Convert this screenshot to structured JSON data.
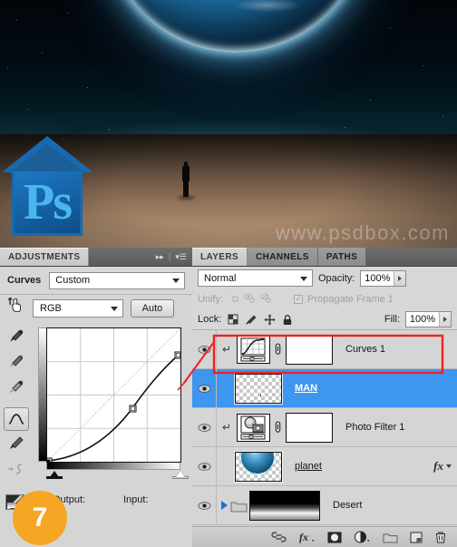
{
  "canvas": {
    "watermark": "www.psdbox.com",
    "logo_text": "Ps",
    "logo_name": "photoshop-house-logo",
    "scene_items": [
      "planet",
      "desert-ground",
      "man-silhouette",
      "starfield"
    ]
  },
  "adjustments_panel": {
    "tabs": [
      {
        "label": "ADJUSTMENTS",
        "active": true
      }
    ],
    "collapse_icon": "double-arrow-right-icon",
    "menu_icon": "panel-menu-icon",
    "title": "Curves",
    "preset": {
      "value": "Custom",
      "placeholder": "Custom"
    },
    "channel": {
      "value": "RGB"
    },
    "auto_button": "Auto",
    "output_label": "Output:",
    "input_label": "Input:",
    "tools": [
      {
        "name": "on-image-adjust-icon",
        "selected": false,
        "dimmed": false
      },
      {
        "name": "black-point-eyedropper-icon",
        "selected": false,
        "dimmed": false
      },
      {
        "name": "gray-point-eyedropper-icon",
        "selected": false,
        "dimmed": false
      },
      {
        "name": "white-point-eyedropper-icon",
        "selected": false,
        "dimmed": false
      },
      {
        "name": "curve-point-tool-icon",
        "selected": true,
        "dimmed": false
      },
      {
        "name": "pencil-draw-curve-icon",
        "selected": false,
        "dimmed": false
      },
      {
        "name": "smooth-curve-icon",
        "selected": false,
        "dimmed": true
      }
    ],
    "clip-swatch-name": "clip-to-layer-swatch"
  },
  "chart_data": {
    "type": "line",
    "title": "Curves RGB tone curve",
    "xlabel": "Input",
    "ylabel": "Output",
    "xlim": [
      0,
      255
    ],
    "ylim": [
      0,
      255
    ],
    "grid": true,
    "grid_divisions": 4,
    "series": [
      {
        "name": "diagonal-baseline",
        "x": [
          0,
          255
        ],
        "y": [
          0,
          255
        ]
      },
      {
        "name": "rgb-curve",
        "x": [
          0,
          163,
          255
        ],
        "y": [
          0,
          102,
          209
        ],
        "control_points": [
          {
            "input": 0,
            "output": 0
          },
          {
            "input": 163,
            "output": 102
          },
          {
            "input": 255,
            "output": 209
          }
        ]
      }
    ],
    "legend": "none"
  },
  "layers_panel": {
    "tabs": [
      {
        "label": "LAYERS",
        "active": true
      },
      {
        "label": "CHANNELS",
        "active": false
      },
      {
        "label": "PATHS",
        "active": false
      }
    ],
    "blend_mode": "Normal",
    "opacity_label": "Opacity:",
    "opacity_value": "100%",
    "unify_label": "Unify:",
    "unify_icons": [
      "unify-position-icon",
      "unify-visibility-icon",
      "unify-style-icon"
    ],
    "propagate_label": "Propagate Frame 1",
    "propagate_checked": true,
    "lock_label": "Lock:",
    "lock_icons": [
      "lock-transparent-pixels-icon",
      "lock-image-pixels-icon",
      "lock-position-icon",
      "lock-all-icon"
    ],
    "fill_label": "Fill:",
    "fill_value": "100%",
    "layers": [
      {
        "name": "Curves 1",
        "type": "adjustment",
        "visible": true,
        "selected": false,
        "clipped": true,
        "thumb": "curves-adjustment-thumbnail",
        "mask": "white-layer-mask-thumbnail",
        "linked": true,
        "highlighted": true
      },
      {
        "name": "MAN",
        "type": "pixel",
        "visible": true,
        "selected": true,
        "clipped": false,
        "thumb": "transparent-checker-thumbnail",
        "linked": false
      },
      {
        "name": "Photo Filter 1",
        "type": "adjustment",
        "visible": true,
        "selected": false,
        "clipped": true,
        "thumb": "photo-filter-adjustment-thumbnail",
        "mask": "white-layer-mask-thumbnail",
        "linked": true
      },
      {
        "name": "planet",
        "type": "pixel",
        "visible": true,
        "selected": false,
        "clipped": false,
        "thumb": "planet-layer-thumbnail",
        "effects_badge": "fx"
      },
      {
        "name": "Desert",
        "type": "group",
        "visible": true,
        "selected": false,
        "expanded": false,
        "thumb": "gradient-mask-thumbnail"
      }
    ],
    "bottom_icons": [
      "link-layers-icon",
      "add-layer-style-icon",
      "add-layer-mask-icon",
      "new-adjustment-layer-icon",
      "new-group-icon",
      "new-layer-icon",
      "delete-layer-icon"
    ]
  },
  "annotation": {
    "step_badge": "7",
    "badge_color": "#f5a623",
    "highlight_color": "#ee2222",
    "highlight_target": "Curves 1"
  }
}
